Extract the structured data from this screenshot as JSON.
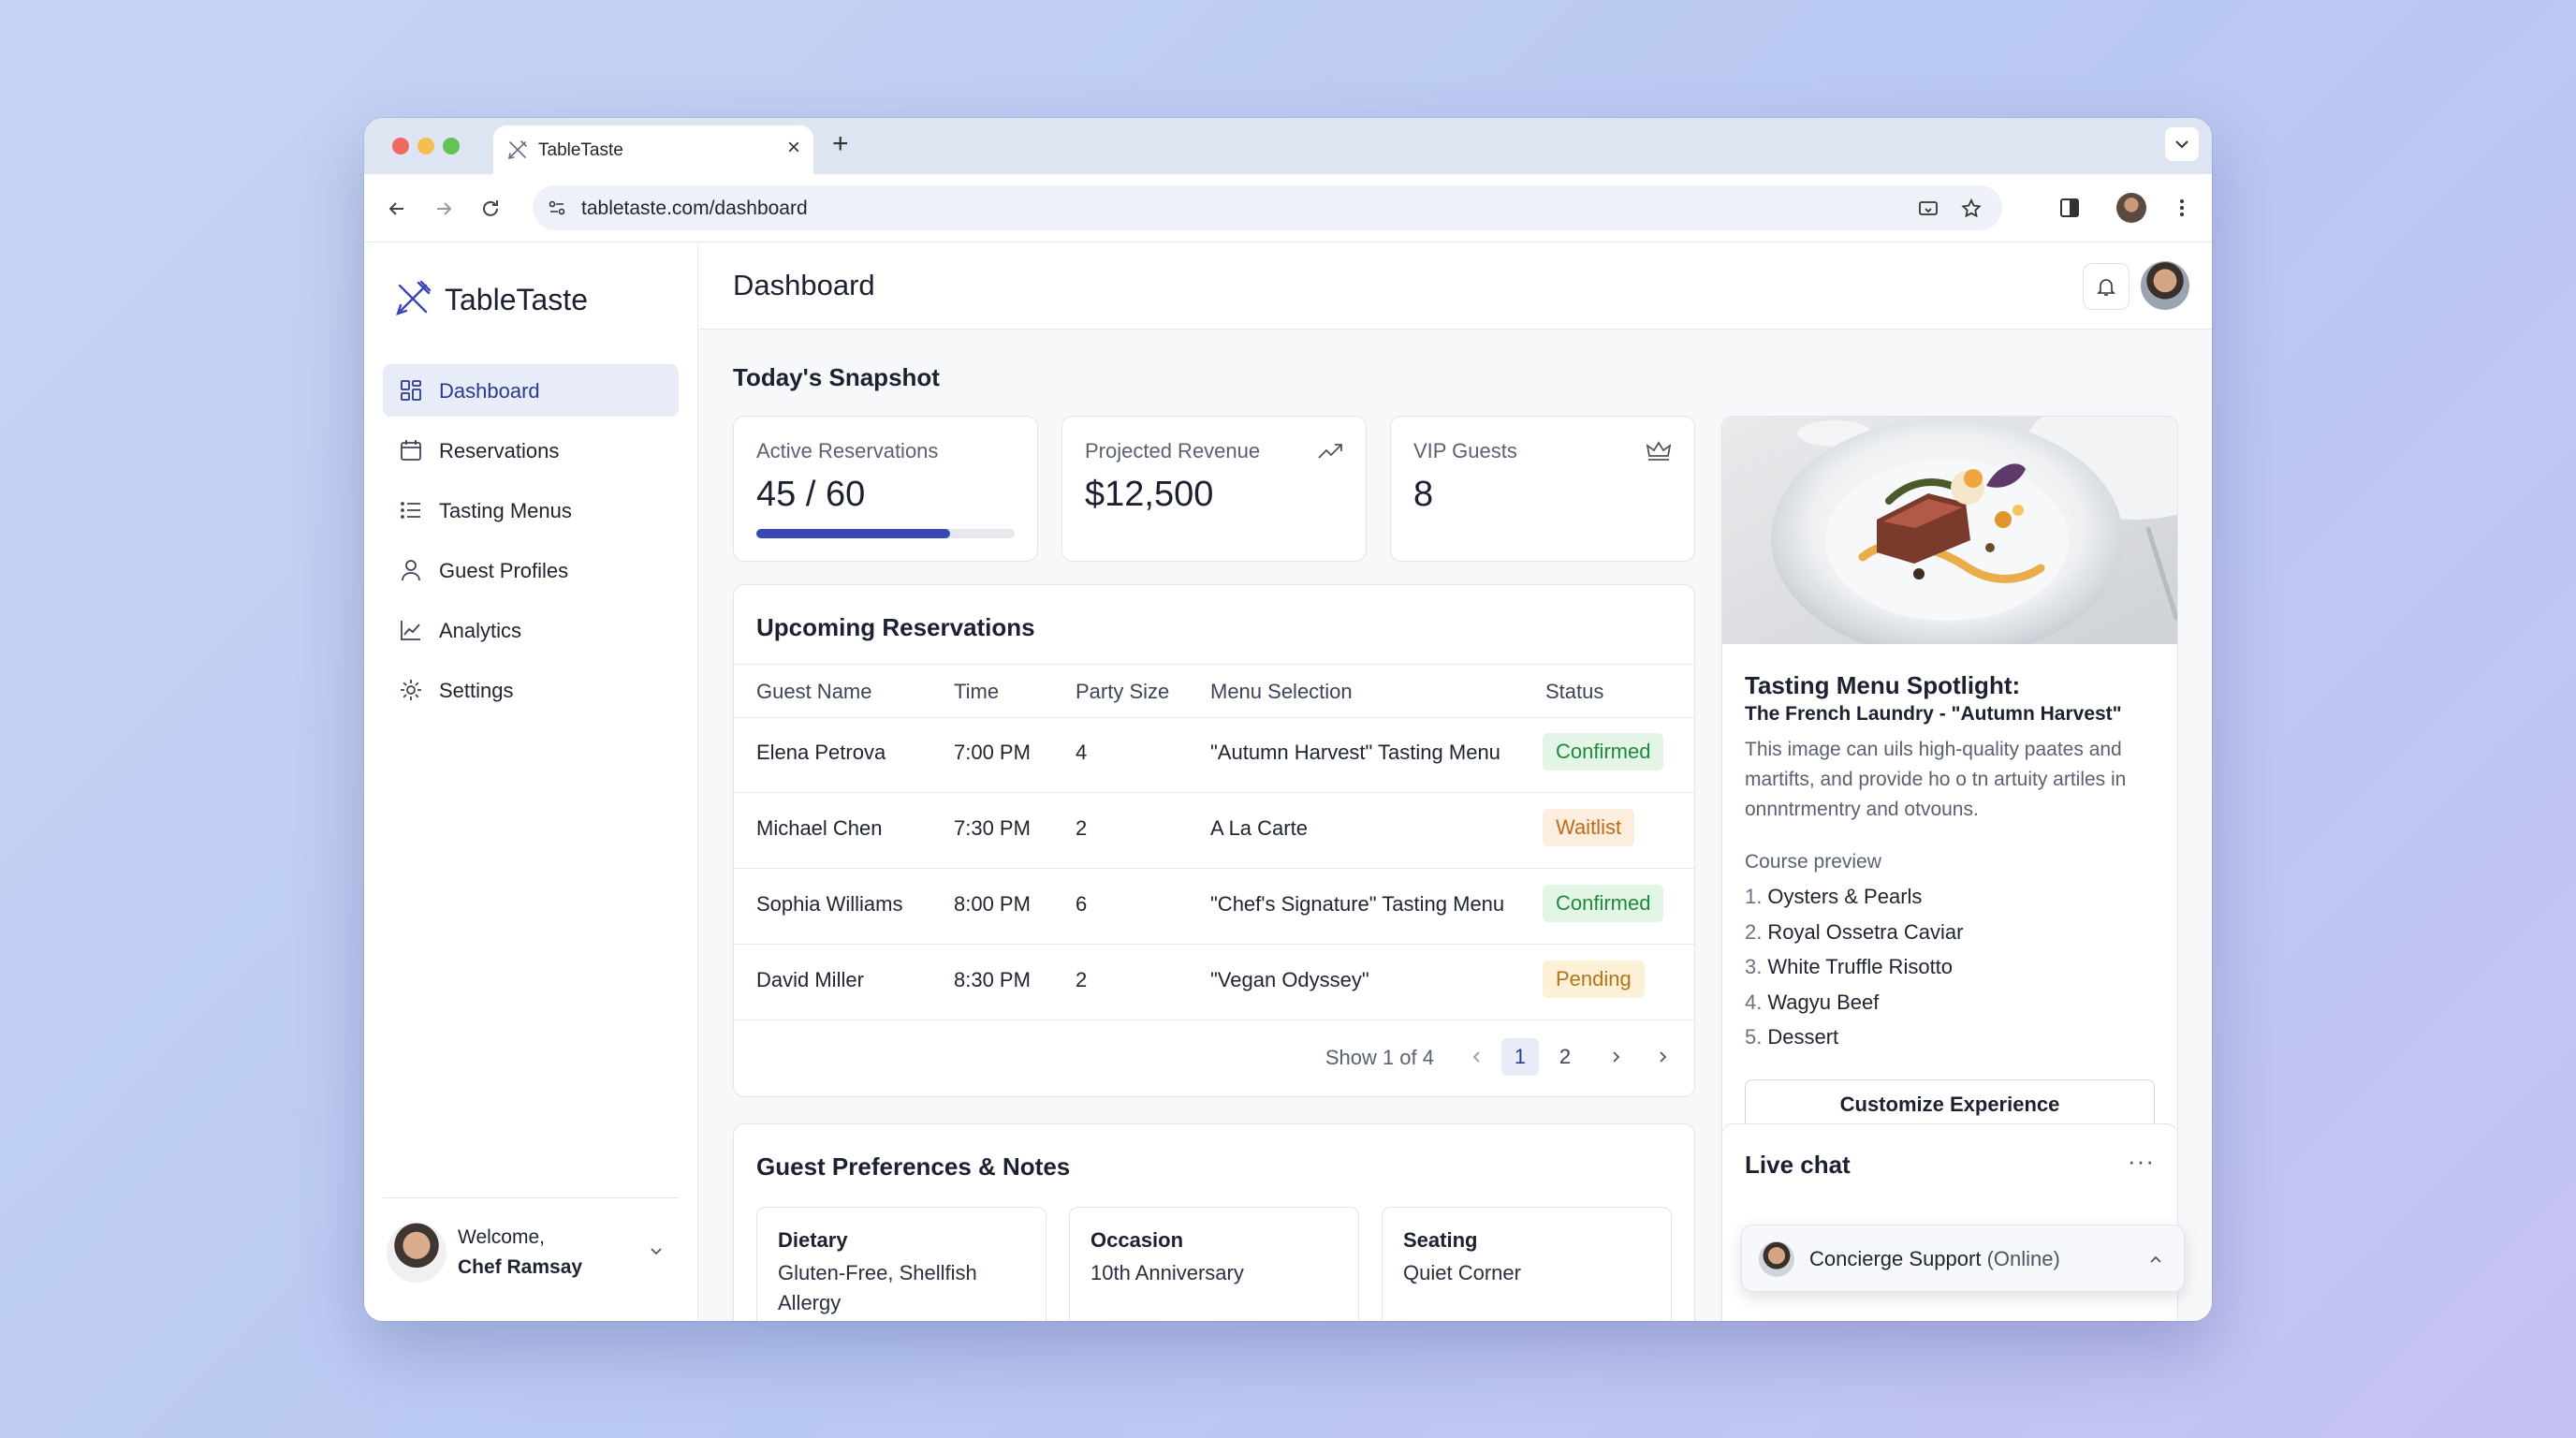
{
  "browser": {
    "tab_title": "TableTaste",
    "url": "tabletaste.com/dashboard"
  },
  "app": {
    "brand": "TableTaste",
    "page_title": "Dashboard"
  },
  "sidebar": {
    "items": [
      {
        "label": "Dashboard",
        "icon": "dashboard-grid-icon",
        "active": true
      },
      {
        "label": "Reservations",
        "icon": "calendar-icon"
      },
      {
        "label": "Tasting Menus",
        "icon": "list-icon"
      },
      {
        "label": "Guest Profiles",
        "icon": "person-icon"
      },
      {
        "label": "Analytics",
        "icon": "chart-line-icon"
      },
      {
        "label": "Settings",
        "icon": "gear-icon"
      }
    ],
    "footer": {
      "welcome": "Welcome,",
      "name": "Chef Ramsay"
    }
  },
  "snapshot": {
    "title": "Today's Snapshot",
    "cards": [
      {
        "label": "Active Reservations",
        "value": "45 / 60",
        "progress": 0.75
      },
      {
        "label": "Projected Revenue",
        "value": "$12,500",
        "icon": "trending-up-icon"
      },
      {
        "label": "VIP Guests",
        "value": "8",
        "icon": "crown-icon"
      }
    ]
  },
  "reservations": {
    "title": "Upcoming Reservations",
    "columns": [
      "Guest Name",
      "Time",
      "Party Size",
      "Menu Selection",
      "Status"
    ],
    "rows": [
      {
        "guest": "Elena Petrova",
        "time": "7:00 PM",
        "party": "4",
        "menu": "\"Autumn Harvest\" Tasting Menu",
        "status": "Confirmed",
        "status_color": "green"
      },
      {
        "guest": "Michael Chen",
        "time": "7:30 PM",
        "party": "2",
        "menu": "A La Carte",
        "status": "Waitlist",
        "status_color": "orange"
      },
      {
        "guest": "Sophia Williams",
        "time": "8:00 PM",
        "party": "6",
        "menu": "\"Chef's Signature\" Tasting Menu",
        "status": "Confirmed",
        "status_color": "green"
      },
      {
        "guest": "David Miller",
        "time": "8:30 PM",
        "party": "2",
        "menu": "\"Vegan Odyssey\"",
        "status": "Pending",
        "status_color": "yellow"
      }
    ],
    "pagination": {
      "info": "Show 1 of 4",
      "pages": [
        "1",
        "2"
      ],
      "current": "1"
    }
  },
  "preferences": {
    "title": "Guest Preferences & Notes",
    "cards": [
      {
        "title": "Dietary",
        "text": "Gluten-Free, Shellfish Allergy"
      },
      {
        "title": "Occasion",
        "text": "10th Anniversary"
      },
      {
        "title": "Seating",
        "text": "Quiet Corner"
      }
    ]
  },
  "spotlight": {
    "title": "Tasting Menu Spotlight:",
    "subtitle": "The French Laundry - \"Autumn Harvest\"",
    "description": "This image can uils high-quality paates and martifts, and provide ho o tn artuity artiles in onnntrmentry and otvouns.",
    "course_label": "Course preview",
    "courses": [
      "Oysters & Pearls",
      "Royal Ossetra Caviar",
      "White Truffle Risotto",
      "Wagyu Beef",
      "Dessert"
    ],
    "button": "Customize Experience"
  },
  "chat": {
    "title": "Live chat",
    "more": "···",
    "agent": "Concierge Support",
    "status": "(Online)"
  }
}
